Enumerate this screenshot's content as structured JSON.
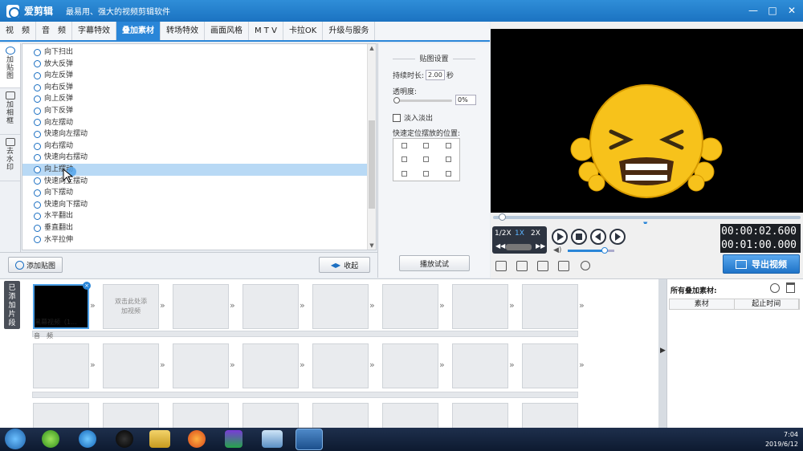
{
  "titlebar": {
    "app_name": "爱剪辑",
    "slogan": "最易用、强大的视频剪辑软件",
    "min": "—",
    "max": "□",
    "close": "✕"
  },
  "menu": [
    "视　频",
    "音　频",
    "字幕特效",
    "叠加素材",
    "转场特效",
    "画面风格",
    "M T V",
    "卡拉OK",
    "升级与服务"
  ],
  "menu_active_index": 3,
  "leftbar": [
    "加贴图",
    "加相框",
    "去水印"
  ],
  "effects": [
    "向下扫出",
    "放大反弹",
    "向左反弹",
    "向右反弹",
    "向上反弹",
    "向下反弹",
    "向左摆动",
    "快速向左摆动",
    "向右摆动",
    "快速向右摆动",
    "向上摆动",
    "快速向上摆动",
    "向下摆动",
    "快速向下摆动",
    "水平翻出",
    "垂直翻出",
    "水平拉伸"
  ],
  "effects_selected": "向上摆动",
  "settings": {
    "title": "贴图设置",
    "duration_label": "持续时长:",
    "duration_value": "2.00",
    "duration_unit": "秒",
    "opacity_label": "透明度:",
    "opacity_value": "0%",
    "fade_label": "淡入淡出",
    "position_label": "快速定位摆放的位置:",
    "play_test": "播放试试"
  },
  "buttons": {
    "add_sticker": "添加贴图",
    "collapse": "收起"
  },
  "player": {
    "speeds": [
      "1/2X",
      "1X",
      "2X"
    ],
    "current_time": "00:00:02.600",
    "total_time": "00:01:00.000",
    "export": "导出视频",
    "progress": 0.03,
    "volume": 0.8
  },
  "lower": {
    "added_tab": "已添加片段",
    "clip_name": "黑幕视频（1...",
    "placeholder": "双击此处添加视频",
    "audio_label": "音　频"
  },
  "rightpanel": {
    "title": "所有叠加素材:",
    "col_material": "素材",
    "col_start": "起止时间"
  },
  "tray": {
    "time": "7:04",
    "date": "2019/6/12"
  },
  "colors": {
    "accent": "#2a86d8",
    "selected_row": "#b8d9f5",
    "emoji": "#f7c21b"
  }
}
